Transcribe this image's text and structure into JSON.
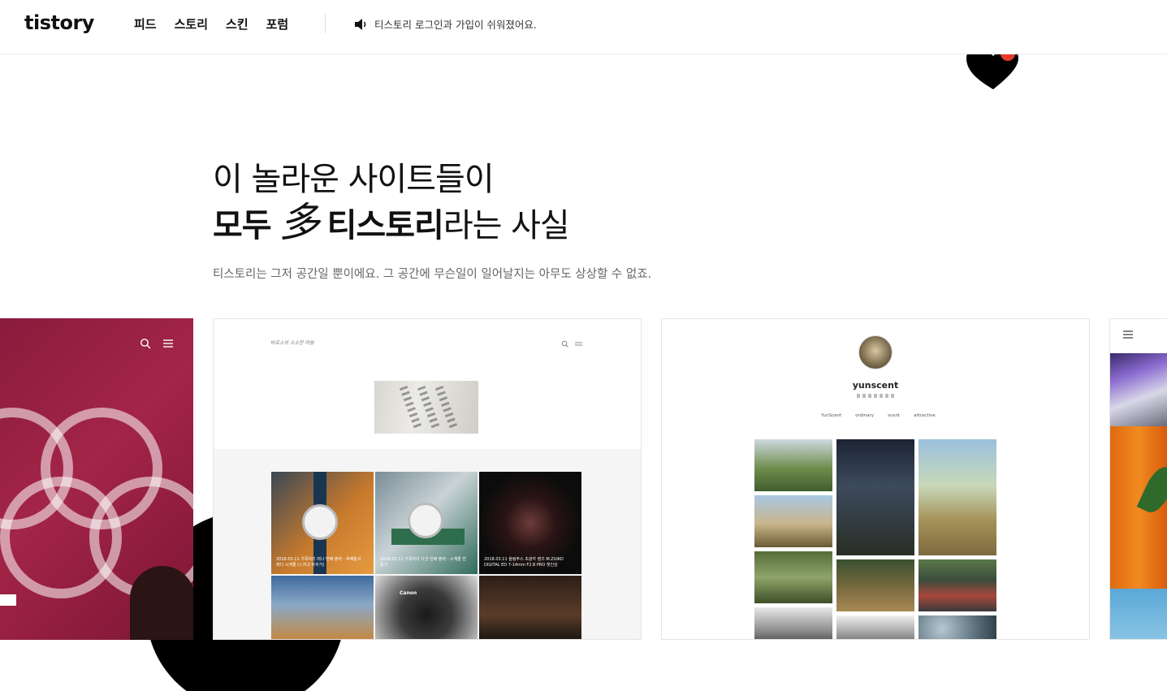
{
  "header": {
    "logo": "tistory",
    "nav": [
      "피드",
      "스토리",
      "스킨",
      "포럼"
    ],
    "notice": "티스토리 로그인과 가입이 쉬워졌어요."
  },
  "hero": {
    "line1": "이 놀라운 사이트들이",
    "line2_bold_a": "모두",
    "line2_char": "多",
    "line2_bold_b": "티스토리",
    "line2_light": "라는 사실",
    "subtitle": "티스토리는 그저 공간일 뿐이에요. 그 공간에 무슨일이 일어날지는 아무도 상상할 수 없죠."
  },
  "cards": {
    "card2": {
      "blog_logo": "비로소의 소소한 마음",
      "posts": [
        {
          "caption": "2018.03.11 가족끼리 떠나 번째 출력 - 후배들과 레디 시계줄 (느끼고 바꾸기)"
        },
        {
          "caption": "2018.03.11 가족끼리 다섯 번째 출력 - 시계줄 만들기"
        },
        {
          "caption": "2018.03.11 올림푸스 초광각 렌즈 M.ZUIKO DIGITAL ED 7-14mm F2.8 PRO 첫인상"
        }
      ],
      "camera_brand": "Canon"
    },
    "card3": {
      "name": "yunscent",
      "menu": [
        "YunScent",
        "ordinary",
        "scent",
        "attractive"
      ]
    }
  },
  "colors": {
    "accent_red": "#e83a2b",
    "olympic_bg": "#a32548",
    "text_primary": "#111111",
    "text_secondary": "#666666"
  },
  "icons": {
    "speaker": "speaker-icon",
    "search": "search-icon",
    "menu": "menu-icon",
    "heart": "heart-icon"
  }
}
